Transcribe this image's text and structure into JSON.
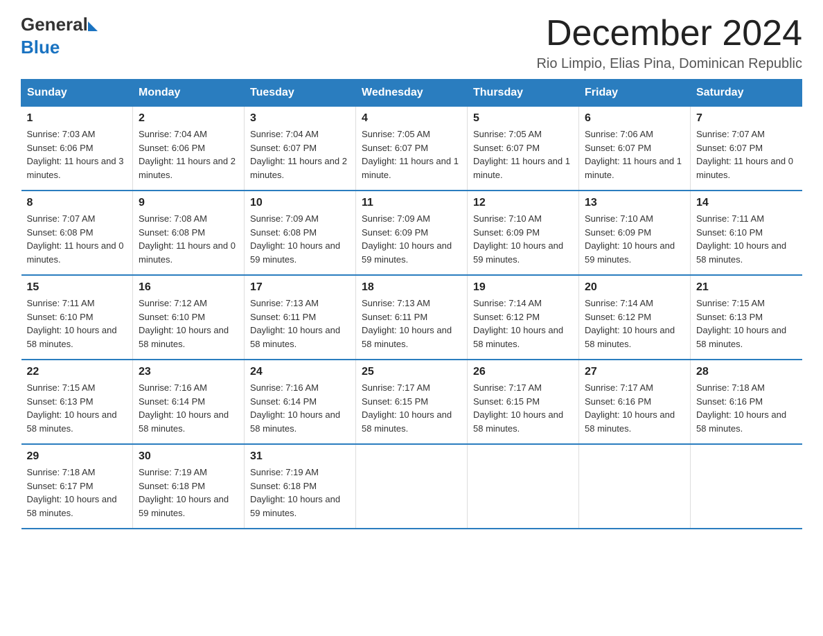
{
  "logo": {
    "text_general": "General",
    "text_blue": "Blue"
  },
  "title": "December 2024",
  "subtitle": "Rio Limpio, Elias Pina, Dominican Republic",
  "days_of_week": [
    "Sunday",
    "Monday",
    "Tuesday",
    "Wednesday",
    "Thursday",
    "Friday",
    "Saturday"
  ],
  "weeks": [
    [
      {
        "day": "1",
        "sunrise": "7:03 AM",
        "sunset": "6:06 PM",
        "daylight": "11 hours and 3 minutes."
      },
      {
        "day": "2",
        "sunrise": "7:04 AM",
        "sunset": "6:06 PM",
        "daylight": "11 hours and 2 minutes."
      },
      {
        "day": "3",
        "sunrise": "7:04 AM",
        "sunset": "6:07 PM",
        "daylight": "11 hours and 2 minutes."
      },
      {
        "day": "4",
        "sunrise": "7:05 AM",
        "sunset": "6:07 PM",
        "daylight": "11 hours and 1 minute."
      },
      {
        "day": "5",
        "sunrise": "7:05 AM",
        "sunset": "6:07 PM",
        "daylight": "11 hours and 1 minute."
      },
      {
        "day": "6",
        "sunrise": "7:06 AM",
        "sunset": "6:07 PM",
        "daylight": "11 hours and 1 minute."
      },
      {
        "day": "7",
        "sunrise": "7:07 AM",
        "sunset": "6:07 PM",
        "daylight": "11 hours and 0 minutes."
      }
    ],
    [
      {
        "day": "8",
        "sunrise": "7:07 AM",
        "sunset": "6:08 PM",
        "daylight": "11 hours and 0 minutes."
      },
      {
        "day": "9",
        "sunrise": "7:08 AM",
        "sunset": "6:08 PM",
        "daylight": "11 hours and 0 minutes."
      },
      {
        "day": "10",
        "sunrise": "7:09 AM",
        "sunset": "6:08 PM",
        "daylight": "10 hours and 59 minutes."
      },
      {
        "day": "11",
        "sunrise": "7:09 AM",
        "sunset": "6:09 PM",
        "daylight": "10 hours and 59 minutes."
      },
      {
        "day": "12",
        "sunrise": "7:10 AM",
        "sunset": "6:09 PM",
        "daylight": "10 hours and 59 minutes."
      },
      {
        "day": "13",
        "sunrise": "7:10 AM",
        "sunset": "6:09 PM",
        "daylight": "10 hours and 59 minutes."
      },
      {
        "day": "14",
        "sunrise": "7:11 AM",
        "sunset": "6:10 PM",
        "daylight": "10 hours and 58 minutes."
      }
    ],
    [
      {
        "day": "15",
        "sunrise": "7:11 AM",
        "sunset": "6:10 PM",
        "daylight": "10 hours and 58 minutes."
      },
      {
        "day": "16",
        "sunrise": "7:12 AM",
        "sunset": "6:10 PM",
        "daylight": "10 hours and 58 minutes."
      },
      {
        "day": "17",
        "sunrise": "7:13 AM",
        "sunset": "6:11 PM",
        "daylight": "10 hours and 58 minutes."
      },
      {
        "day": "18",
        "sunrise": "7:13 AM",
        "sunset": "6:11 PM",
        "daylight": "10 hours and 58 minutes."
      },
      {
        "day": "19",
        "sunrise": "7:14 AM",
        "sunset": "6:12 PM",
        "daylight": "10 hours and 58 minutes."
      },
      {
        "day": "20",
        "sunrise": "7:14 AM",
        "sunset": "6:12 PM",
        "daylight": "10 hours and 58 minutes."
      },
      {
        "day": "21",
        "sunrise": "7:15 AM",
        "sunset": "6:13 PM",
        "daylight": "10 hours and 58 minutes."
      }
    ],
    [
      {
        "day": "22",
        "sunrise": "7:15 AM",
        "sunset": "6:13 PM",
        "daylight": "10 hours and 58 minutes."
      },
      {
        "day": "23",
        "sunrise": "7:16 AM",
        "sunset": "6:14 PM",
        "daylight": "10 hours and 58 minutes."
      },
      {
        "day": "24",
        "sunrise": "7:16 AM",
        "sunset": "6:14 PM",
        "daylight": "10 hours and 58 minutes."
      },
      {
        "day": "25",
        "sunrise": "7:17 AM",
        "sunset": "6:15 PM",
        "daylight": "10 hours and 58 minutes."
      },
      {
        "day": "26",
        "sunrise": "7:17 AM",
        "sunset": "6:15 PM",
        "daylight": "10 hours and 58 minutes."
      },
      {
        "day": "27",
        "sunrise": "7:17 AM",
        "sunset": "6:16 PM",
        "daylight": "10 hours and 58 minutes."
      },
      {
        "day": "28",
        "sunrise": "7:18 AM",
        "sunset": "6:16 PM",
        "daylight": "10 hours and 58 minutes."
      }
    ],
    [
      {
        "day": "29",
        "sunrise": "7:18 AM",
        "sunset": "6:17 PM",
        "daylight": "10 hours and 58 minutes."
      },
      {
        "day": "30",
        "sunrise": "7:19 AM",
        "sunset": "6:18 PM",
        "daylight": "10 hours and 59 minutes."
      },
      {
        "day": "31",
        "sunrise": "7:19 AM",
        "sunset": "6:18 PM",
        "daylight": "10 hours and 59 minutes."
      },
      null,
      null,
      null,
      null
    ]
  ],
  "labels": {
    "sunrise": "Sunrise:",
    "sunset": "Sunset:",
    "daylight": "Daylight:"
  },
  "colors": {
    "header_bg": "#2a7dbf",
    "border": "#2a7dbf"
  }
}
